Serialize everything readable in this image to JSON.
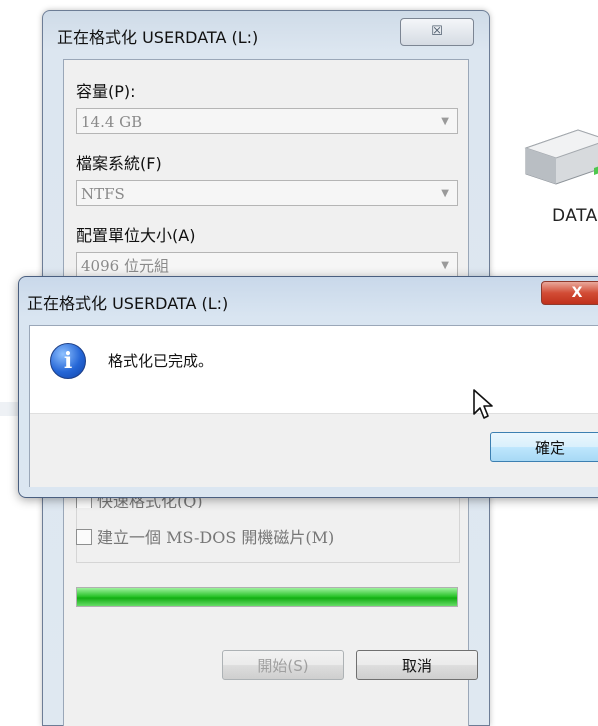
{
  "background": {
    "drive_label": "DATA"
  },
  "format_dialog": {
    "title": "正在格式化 USERDATA (L:)",
    "close_glyph": "☒",
    "capacity_label": "容量(P):",
    "capacity_value": "14.4 GB",
    "filesystem_label": "檔案系統(F)",
    "filesystem_value": "NTFS",
    "allocation_label": "配置單位大小(A)",
    "allocation_value": "4096 位元組",
    "quick_format_label": "快速格式化(Q)",
    "msdos_disk_label": "建立一個 MS-DOS 開機磁片(M)",
    "progress_percent": 100,
    "start_button": "開始(S)",
    "cancel_button": "取消"
  },
  "message_box": {
    "title": "正在格式化 USERDATA (L:)",
    "close_glyph": "X",
    "icon": "info-icon",
    "message": "格式化已完成。",
    "ok_button": "確定"
  },
  "colors": {
    "progress": "#23c023",
    "close_red": "#d24c35",
    "info_blue": "#2566d6"
  }
}
